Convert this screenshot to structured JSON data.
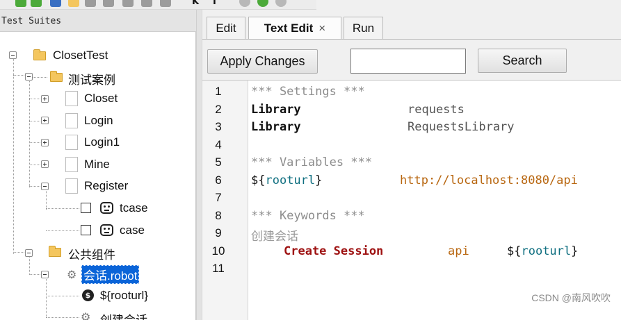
{
  "toolbar": {
    "glyphs": [
      "K",
      "T"
    ]
  },
  "left_panel": {
    "title": "Test Suites",
    "tree": {
      "root": "ClosetTest",
      "cases_folder": "测试案例",
      "cases": [
        "Closet",
        "Login",
        "Login1",
        "Mine",
        "Register"
      ],
      "register_tests": [
        "tcase",
        "case"
      ],
      "common_folder": "公共组件",
      "resource": "会话.robot",
      "resource_variable": "${rooturl}",
      "resource_keyword": "创建会话"
    }
  },
  "tabs": [
    {
      "label": "Edit"
    },
    {
      "label": "Text Edit",
      "close": "×"
    },
    {
      "label": "Run"
    }
  ],
  "actions": {
    "apply_label": "Apply Changes",
    "search_label": "Search",
    "search_value": ""
  },
  "editor": {
    "line_numbers": [
      "1",
      "2",
      "3",
      "4",
      "5",
      "6",
      "7",
      "8",
      "9",
      "10",
      "11"
    ],
    "settings_header": "*** Settings ***",
    "lib1_kw": "Library",
    "lib1_arg": "requests",
    "lib2_kw": "Library",
    "lib2_arg": "RequestsLibrary",
    "variables_header": "*** Variables ***",
    "var_open": "${",
    "var_name": "rooturl",
    "var_close": "}",
    "var_value": "http://localhost:8080/api",
    "keywords_header": "*** Keywords ***",
    "keyword_name": "创建会话",
    "create_session": "Create Session",
    "session_alias": "api",
    "arg_open": "${",
    "arg_name": "rooturl",
    "arg_close": "}"
  },
  "watermark": "CSDN @南风吹吹"
}
